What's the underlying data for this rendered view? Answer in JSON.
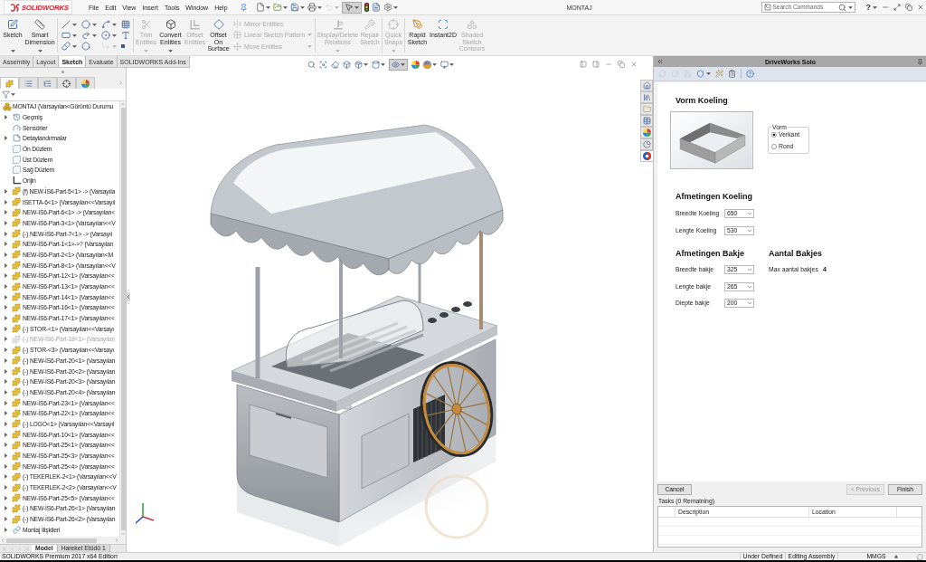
{
  "app_bar": {
    "logo_text": "SOLIDWORKS",
    "menu": [
      "File",
      "Edit",
      "View",
      "Insert",
      "Tools",
      "Window",
      "Help"
    ],
    "quick_access": [
      {
        "dropdown": true,
        "pressed": false,
        "disabled": false
      },
      {
        "dropdown": true,
        "pressed": false,
        "disabled": false
      },
      {
        "dropdown": true,
        "pressed": false,
        "disabled": false
      },
      {
        "dropdown": true,
        "pressed": false,
        "disabled": false
      },
      {
        "dropdown": true,
        "pressed": false,
        "disabled": true
      },
      {
        "dropdown": true,
        "pressed": true,
        "disabled": false
      },
      {
        "dropdown": false,
        "pressed": false,
        "disabled": false
      },
      {
        "dropdown": false,
        "pressed": false,
        "disabled": false
      },
      {
        "dropdown": true,
        "pressed": false,
        "disabled": false
      }
    ],
    "document_title": "MONTAJ",
    "search": {
      "placeholder": "Search Commands"
    },
    "help": "?"
  },
  "command_manager": {
    "commands": [
      {
        "kind": "large",
        "label": "Sketch",
        "dropdown": true,
        "disabled": false
      },
      {
        "kind": "large",
        "label": "Smart Dimension",
        "dropdown": true,
        "disabled": false
      },
      {
        "kind": "separator"
      },
      {
        "kind": "grid",
        "tools": [
          {
            "dropdown": true,
            "disabled": false
          },
          {
            "dropdown": true,
            "disabled": false
          },
          {
            "dropdown": true,
            "disabled": false
          },
          {
            "dropdown": false,
            "disabled": false
          },
          {
            "dropdown": true,
            "disabled": false
          },
          {
            "dropdown": true,
            "disabled": false
          },
          {
            "dropdown": true,
            "disabled": false
          },
          {
            "dropdown": false,
            "disabled": false
          },
          {
            "dropdown": true,
            "disabled": false
          },
          {
            "dropdown": false,
            "disabled": false
          },
          {
            "dropdown": true,
            "disabled": true
          },
          {
            "dropdown": false,
            "disabled": false
          }
        ]
      },
      {
        "kind": "separator"
      },
      {
        "kind": "large",
        "label": "Trim Entities",
        "dropdown": true,
        "disabled": true
      },
      {
        "kind": "large",
        "label": "Convert Entities",
        "dropdown": true,
        "disabled": false
      },
      {
        "kind": "large",
        "label": "Offset Entities",
        "dropdown": false,
        "disabled": true
      },
      {
        "kind": "large",
        "label": "Offset On Surface",
        "dropdown": false,
        "disabled": false
      },
      {
        "kind": "stack",
        "items": [
          {
            "label": "Mirror Entities",
            "dropdown": false,
            "disabled": true
          },
          {
            "label": "Linear Sketch Pattern",
            "dropdown": true,
            "disabled": true
          },
          {
            "label": "Move Entities",
            "dropdown": true,
            "disabled": true
          }
        ]
      },
      {
        "kind": "separator"
      },
      {
        "kind": "large",
        "label": "Display/Delete Relations",
        "dropdown": true,
        "disabled": true
      },
      {
        "kind": "large",
        "label": "Repair Sketch",
        "dropdown": false,
        "disabled": true
      },
      {
        "kind": "separator"
      },
      {
        "kind": "large",
        "label": "Quick Snaps",
        "dropdown": true,
        "disabled": true
      },
      {
        "kind": "separator"
      },
      {
        "kind": "large",
        "label": "Rapid Sketch",
        "dropdown": false,
        "disabled": false
      },
      {
        "kind": "large",
        "label": "Instant2D",
        "dropdown": false,
        "disabled": false
      },
      {
        "kind": "large",
        "label": "Shaded Sketch Contours",
        "dropdown": false,
        "disabled": true
      }
    ]
  },
  "ribbon_tabs": [
    {
      "label": "Assembly",
      "selected": false
    },
    {
      "label": "Layout",
      "selected": false
    },
    {
      "label": "Sketch",
      "selected": true
    },
    {
      "label": "Evaluate",
      "selected": false
    },
    {
      "label": "SOLIDWORKS Add-Ins",
      "selected": false
    }
  ],
  "feature_manager": {
    "panel_tabs": [
      {
        "selected": true
      },
      {
        "selected": false
      },
      {
        "selected": false
      },
      {
        "selected": false
      },
      {
        "selected": false
      }
    ],
    "tree": {
      "kind": "assembly",
      "label": "MONTAJ (Varsayılan<Görüntü Durumu",
      "children": [
        {
          "kind": "history",
          "label": "Geçmiş",
          "expandable": true,
          "suppressed": false
        },
        {
          "kind": "sensors",
          "label": "Sensörler",
          "expandable": false,
          "suppressed": false
        },
        {
          "kind": "annotations",
          "label": "Detaylandırmalar",
          "expandable": true,
          "suppressed": false
        },
        {
          "kind": "plane",
          "label": "Ön Düzlem",
          "expandable": false,
          "suppressed": false
        },
        {
          "kind": "plane",
          "label": "Üst Düzlem",
          "expandable": false,
          "suppressed": false
        },
        {
          "kind": "plane",
          "label": "Sağ Düzlem",
          "expandable": false,
          "suppressed": false
        },
        {
          "kind": "origin",
          "label": "Orijin",
          "expandable": false,
          "suppressed": false
        },
        {
          "kind": "component",
          "label": "(f) NEW-İS6-Part-5<1> -> (Varsayıla",
          "expandable": true,
          "suppressed": false
        },
        {
          "kind": "component",
          "label": "ISETTA-6<1> (Varsayılan<<Varsayıl",
          "expandable": true,
          "suppressed": false
        },
        {
          "kind": "component",
          "label": "NEW-İS6-Part-6<1> -> (Varsayılan<",
          "expandable": true,
          "suppressed": false
        },
        {
          "kind": "component",
          "label": "NEW-İS6-Part-3<1> (Varsayılan<<V",
          "expandable": true,
          "suppressed": false
        },
        {
          "kind": "component",
          "label": "(-) NEW-İS6-Part-7<1> -> (Varsayıl",
          "expandable": true,
          "suppressed": false
        },
        {
          "kind": "component",
          "label": "NEW-İS6-Part-1<1>->? (Varsayılan",
          "expandable": true,
          "suppressed": false
        },
        {
          "kind": "component",
          "label": "NEW-İS6-Part-2<1> (Varsayılan<M",
          "expandable": true,
          "suppressed": false
        },
        {
          "kind": "component",
          "label": "NEW-İS6-Part-8<1> (Varsayılan<<V",
          "expandable": true,
          "suppressed": false
        },
        {
          "kind": "component",
          "label": "NEW-İS6-Part-12<1> (Varsayılan<<",
          "expandable": true,
          "suppressed": false
        },
        {
          "kind": "component",
          "label": "NEW-İS6-Part-13<1> (Varsayılan<<",
          "expandable": true,
          "suppressed": false
        },
        {
          "kind": "component",
          "label": "NEW-İS6-Part-14<1> (Varsayılan<<",
          "expandable": true,
          "suppressed": false
        },
        {
          "kind": "component",
          "label": "NEW-İS6-Part-16<1> (Varsayılan<<",
          "expandable": true,
          "suppressed": false
        },
        {
          "kind": "component",
          "label": "NEW-İS6-Part-17<1> (Varsayılan<<",
          "expandable": true,
          "suppressed": false
        },
        {
          "kind": "component",
          "label": "(-) STOR-<1> (Varsayılan<<Varsayı",
          "expandable": true,
          "suppressed": false
        },
        {
          "kind": "component",
          "label": "(-) NEW-İS6-Part-18<1> (Varsayılan",
          "expandable": true,
          "suppressed": true
        },
        {
          "kind": "component",
          "label": "(-) STOR-<3> (Varsayılan<<Varsayı",
          "expandable": true,
          "suppressed": false
        },
        {
          "kind": "component",
          "label": "(-) NEW-İS6-Part-20<1> (Varsayılan",
          "expandable": true,
          "suppressed": false
        },
        {
          "kind": "component",
          "label": "(-) NEW-İS6-Part-20<2> (Varsayılan",
          "expandable": true,
          "suppressed": false
        },
        {
          "kind": "component",
          "label": "(-) NEW-İS6-Part-20<3> (Varsayılan",
          "expandable": true,
          "suppressed": false
        },
        {
          "kind": "component",
          "label": "(-) NEW-İS6-Part-20<4> (Varsayılan",
          "expandable": true,
          "suppressed": false
        },
        {
          "kind": "component",
          "label": "NEW-İS6-Part-23<1> (Varsayılan<<",
          "expandable": true,
          "suppressed": false
        },
        {
          "kind": "component",
          "label": "NEW-İS6-Part-22<1> (Varsayılan<<",
          "expandable": true,
          "suppressed": false
        },
        {
          "kind": "component",
          "label": "(-) LOGO<1> (Varsayılan<<Varsayıl",
          "expandable": true,
          "suppressed": false
        },
        {
          "kind": "component",
          "label": "NEW-İS6-Part-10<1> (Varsayılan<<",
          "expandable": true,
          "suppressed": false
        },
        {
          "kind": "component",
          "label": "NEW-İS6-Part-25<1> (Varsayılan<<",
          "expandable": true,
          "suppressed": false
        },
        {
          "kind": "component",
          "label": "NEW-İS6-Part-25<3> (Varsayılan<<",
          "expandable": true,
          "suppressed": false
        },
        {
          "kind": "component",
          "label": "NEW-İS6-Part-25<4> (Varsayılan<<",
          "expandable": true,
          "suppressed": false
        },
        {
          "kind": "component",
          "label": "(-) TEKERLEK-2<1> (Varsayılan<<V",
          "expandable": true,
          "suppressed": false
        },
        {
          "kind": "component",
          "label": "(-) TEKERLEK-2<2> (Varsayılan<<V",
          "expandable": true,
          "suppressed": false
        },
        {
          "kind": "component",
          "label": "NEW-İS6-Part-25<5> (Varsayılan<<",
          "expandable": true,
          "suppressed": false
        },
        {
          "kind": "component",
          "label": "(-) NEW-İS6-Part-26<1> (Varsayılan",
          "expandable": true,
          "suppressed": false
        },
        {
          "kind": "component",
          "label": "(-) NEW-İS6-Part-26<2> (Varsayılan",
          "expandable": true,
          "suppressed": false
        },
        {
          "kind": "mates",
          "label": "Montaj İlişkileri",
          "expandable": true,
          "suppressed": false
        }
      ]
    },
    "bottom_tabs": [
      {
        "label": "Model",
        "selected": true
      },
      {
        "label": "Hareket Etüdü 1",
        "selected": false
      }
    ]
  },
  "viewport": {
    "view_tools": [
      {
        "dropdown": false,
        "pressed": false
      },
      {
        "dropdown": false,
        "pressed": false
      },
      {
        "dropdown": false,
        "pressed": false
      },
      {
        "dropdown": false,
        "pressed": false
      },
      {
        "dropdown": true,
        "pressed": false
      },
      {
        "dropdown": true,
        "pressed": false
      },
      {
        "dropdown": true,
        "pressed": true
      },
      {
        "dropdown": false,
        "pressed": false
      },
      {
        "dropdown": true,
        "pressed": false
      },
      {
        "dropdown": true,
        "pressed": false
      }
    ],
    "task_pane_tabs": [
      {
        "selected": false
      },
      {
        "selected": false
      },
      {
        "selected": false
      },
      {
        "selected": false
      },
      {
        "selected": false
      },
      {
        "selected": false
      },
      {
        "selected": true
      }
    ]
  },
  "driveworks": {
    "title": "DriveWorks Solo",
    "toolbar": [
      {
        "disabled": true,
        "dropdown": false
      },
      {
        "disabled": true,
        "dropdown": false
      },
      {
        "disabled": true,
        "dropdown": false
      },
      {
        "disabled": false,
        "dropdown": true
      },
      {
        "disabled": false,
        "dropdown": false
      },
      {
        "disabled": false,
        "dropdown": false
      },
      {
        "disabled": false,
        "dropdown": false
      }
    ],
    "form": {
      "shape_heading": "Vorm Koeling",
      "shape_group": {
        "legend": "Vorm",
        "options": [
          {
            "label": "Verkant",
            "selected": true
          },
          {
            "label": "Rond",
            "selected": false
          }
        ]
      },
      "cooling_heading": "Afmetingen Koeling",
      "cooling_fields": [
        {
          "label": "Breedte Koeling",
          "value": "650"
        },
        {
          "label": "Lengte Koeling",
          "value": "530"
        }
      ],
      "tray_heading": "Afmetingen Bakje",
      "tray_fields": [
        {
          "label": "Breedte bakje",
          "value": "325"
        },
        {
          "label": "Lengte bakje",
          "value": "265"
        },
        {
          "label": "Diepte bakje",
          "value": "200"
        }
      ],
      "count_heading": "Aantal Bakjes",
      "count_label": "Max aantal bakjes",
      "count_value": "4"
    },
    "buttons": [
      {
        "label": "Cancel",
        "disabled": false
      },
      {
        "label": "< Previous",
        "disabled": true
      },
      {
        "label": "Finish",
        "disabled": false
      }
    ],
    "tasks": {
      "title": "Tasks (0 Remaining)",
      "columns": [
        "Description",
        "Location"
      ]
    }
  },
  "status_bar": {
    "edition": "SOLIDWORKS Premium 2017 x64 Edition",
    "state": "Under Defined",
    "mode": "Editing Assembly",
    "units": "MMGS"
  }
}
